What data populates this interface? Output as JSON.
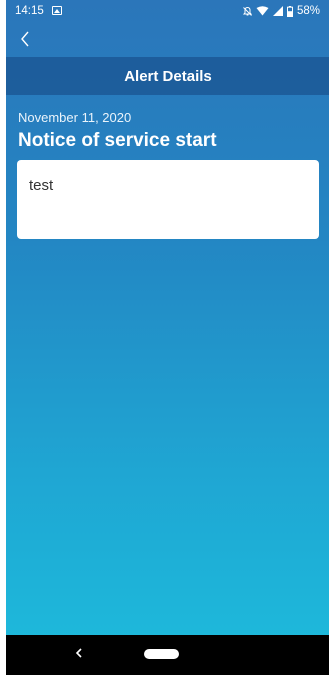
{
  "status_bar": {
    "time": "14:15",
    "battery": "58%",
    "icons": [
      "image-icon",
      "bell-off-icon",
      "wifi-icon",
      "signal-icon",
      "battery-icon"
    ]
  },
  "header": {
    "back_icon": "chevron-left-icon",
    "title": "Alert Details"
  },
  "alert": {
    "date": "November 11, 2020",
    "title": "Notice of service start",
    "message": "test"
  },
  "navigation_bar": {
    "icons": [
      "back-triangle-icon",
      "home-pill-icon"
    ]
  },
  "colors": {
    "gradient_top": "#2b76ba",
    "gradient_bottom": "#1dbcdc",
    "title_bar": "#1d5a97",
    "card": "#ffffff",
    "nav_bar": "#000000"
  }
}
